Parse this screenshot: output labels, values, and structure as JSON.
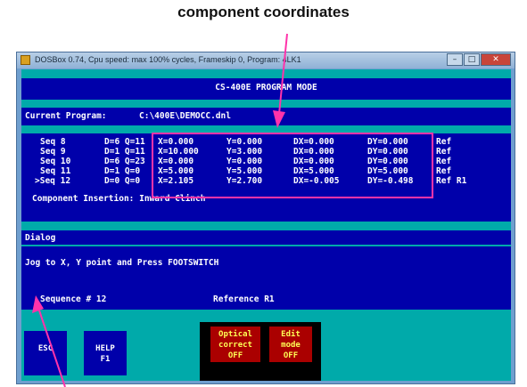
{
  "annotations": {
    "top_label": "component coordinates"
  },
  "window": {
    "title": "DOSBox 0.74, Cpu speed: max 100% cycles, Frameskip 0, Program:   4LK1"
  },
  "screen": {
    "header": "CS-400E PROGRAM MODE",
    "current_program_label": "Current Program:",
    "current_program_value": "C:\\400E\\DEMOCC.dnl",
    "rows": [
      {
        "seq": "Seq 8",
        "dq": "D=6 Q=11",
        "x": "X=0.000",
        "y": "Y=0.000",
        "dx": "DX=0.000",
        "dy": "DY=0.000",
        "ref": "Ref"
      },
      {
        "seq": "Seq 9",
        "dq": "D=1 Q=11",
        "x": "X=10.000",
        "y": "Y=3.000",
        "dx": "DX=0.000",
        "dy": "DY=0.000",
        "ref": "Ref"
      },
      {
        "seq": "Seq 10",
        "dq": "D=6 Q=23",
        "x": "X=0.000",
        "y": "Y=0.000",
        "dx": "DX=0.000",
        "dy": "DY=0.000",
        "ref": "Ref"
      },
      {
        "seq": "Seq 11",
        "dq": "D=1 Q=0",
        "x": "X=5.000",
        "y": "Y=5.000",
        "dx": "DX=5.000",
        "dy": "DY=5.000",
        "ref": "Ref"
      },
      {
        "seq": ">Seq 12",
        "dq": "D=0 Q=0",
        "x": "X=2.105",
        "y": "Y=2.700",
        "dx": "DX=-0.005",
        "dy": "DY=-0.498",
        "ref": "Ref R1"
      }
    ],
    "component_insertion": "Component Insertion: Inward Clinch",
    "dialog_title": "Dialog",
    "dialog_message": "Jog to X, Y point and Press FOOTSWITCH",
    "sequence_status": "Sequence # 12",
    "reference_status": "Reference R1"
  },
  "function_keys": {
    "esc": "ESC",
    "help_line1": "HELP",
    "help_line2": "F1",
    "optical_line1": "Optical",
    "optical_line2": "correct",
    "optical_line3": "OFF",
    "edit_line1": "Edit",
    "edit_line2": "mode",
    "edit_line3": "OFF"
  },
  "colors": {
    "screen_bg": "#0000aa",
    "bar_cyan": "#00aaaa",
    "highlight_box": "#ff33aa",
    "button_red": "#aa0000"
  }
}
